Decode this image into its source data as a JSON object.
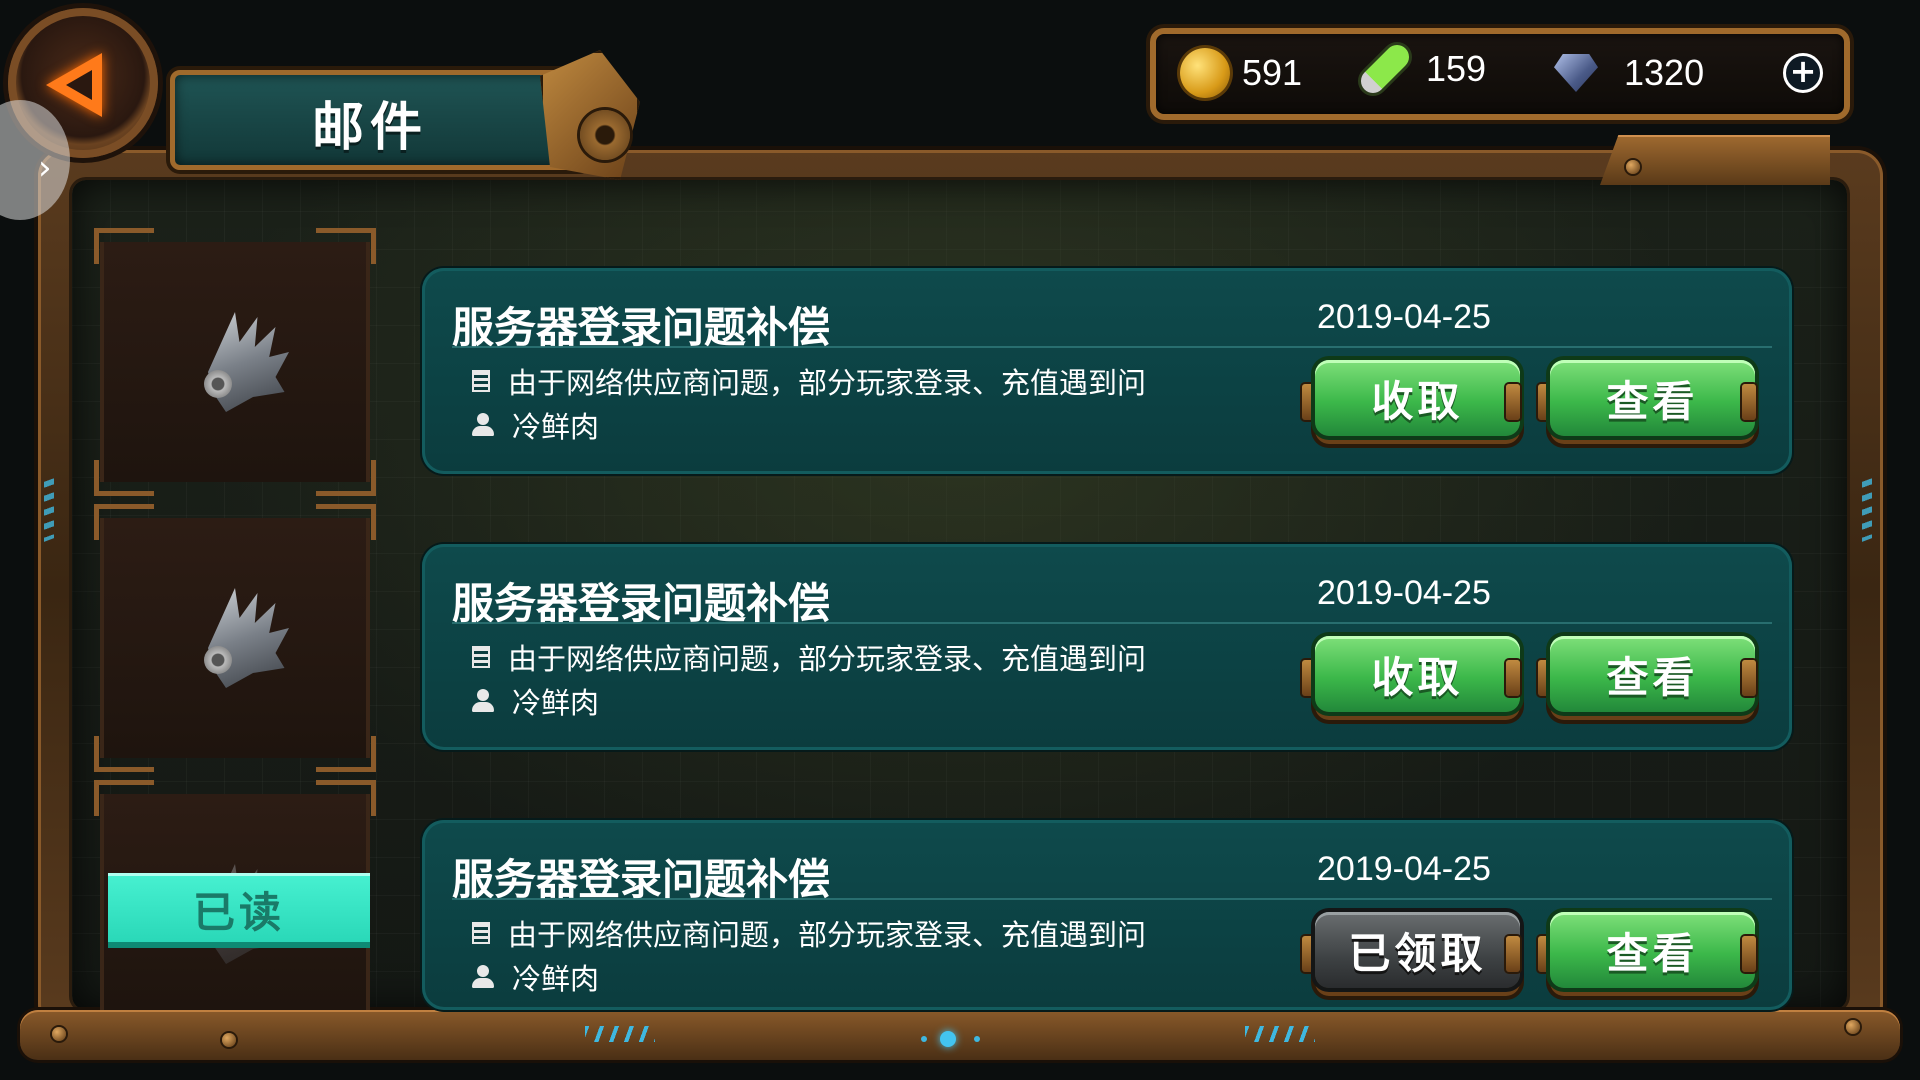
{
  "header": {
    "title": "邮件",
    "back_icon": "back-arrow-icon",
    "side_toggle_icon": "chevron-right-icon",
    "side_toggle_glyph": "›"
  },
  "currencies": [
    {
      "icon": "coin-icon",
      "value": "591"
    },
    {
      "icon": "energy-vial-icon",
      "value": "159"
    },
    {
      "icon": "diamond-icon",
      "value": "1320"
    }
  ],
  "add_currency_glyph": "+",
  "slots": [
    {
      "icon": "wing-icon",
      "badge": ""
    },
    {
      "icon": "wing-icon",
      "badge": ""
    },
    {
      "icon": "wing-icon",
      "badge": "已读"
    }
  ],
  "mails": [
    {
      "title": "服务器登录问题补偿",
      "date": "2019-04-25",
      "preview": "由于网络供应商问题，部分玩家登录、充值遇到问",
      "sender": "冷鲜肉",
      "claim_label": "收取",
      "claim_state": "available",
      "view_label": "查看"
    },
    {
      "title": "服务器登录问题补偿",
      "date": "2019-04-25",
      "preview": "由于网络供应商问题，部分玩家登录、充值遇到问",
      "sender": "冷鲜肉",
      "claim_label": "收取",
      "claim_state": "available",
      "view_label": "查看"
    },
    {
      "title": "服务器登录问题补偿",
      "date": "2019-04-25",
      "preview": "由于网络供应商问题，部分玩家登录、充值遇到问",
      "sender": "冷鲜肉",
      "claim_label": "已领取",
      "claim_state": "claimed",
      "view_label": "查看"
    }
  ],
  "pagination": {
    "pages": 3,
    "current": 2
  },
  "colors": {
    "accent_cyan": "#43c4f0",
    "card_teal": "#0e4a4c",
    "button_green": "#3cb84a",
    "button_grey": "#3e4244",
    "read_badge": "#2ad8b8",
    "frame_bronze": "#a06a2c"
  }
}
